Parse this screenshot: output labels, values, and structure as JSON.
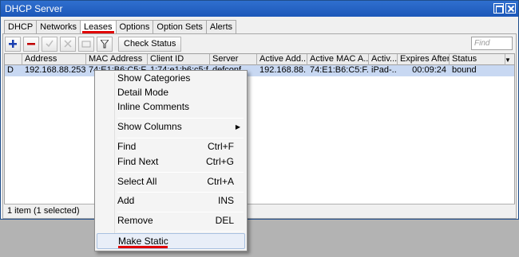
{
  "window": {
    "title": "DHCP Server"
  },
  "tabs": [
    "DHCP",
    "Networks",
    "Leases",
    "Options",
    "Option Sets",
    "Alerts"
  ],
  "toolbar": {
    "check_status": "Check Status",
    "find_placeholder": "Find"
  },
  "columns": [
    "",
    "Address",
    "MAC Address",
    "Client ID",
    "Server",
    "Active Add...",
    "Active MAC A...",
    "Activ...",
    "Expires After",
    "Status"
  ],
  "row": {
    "flag": "D",
    "address": "192.168.88.253",
    "mac": "74:E1:B6:C5:F...",
    "client_id": "1:74:e1:b6:c5:f...",
    "server": "defconf",
    "active_address": "192.168.88...",
    "active_mac": "74:E1:B6:C5:F...",
    "active_host": "iPad-...",
    "expires_after": "00:09:24",
    "status": "bound"
  },
  "status": "1 item (1 selected)",
  "menu": {
    "show_categories": "Show Categories",
    "detail_mode": "Detail Mode",
    "inline_comments": "Inline Comments",
    "show_columns": "Show Columns",
    "find": "Find",
    "find_sc": "Ctrl+F",
    "find_next": "Find Next",
    "find_next_sc": "Ctrl+G",
    "select_all": "Select All",
    "select_all_sc": "Ctrl+A",
    "add": "Add",
    "add_sc": "INS",
    "remove": "Remove",
    "remove_sc": "DEL",
    "make_static": "Make Static"
  },
  "colors": {
    "accent_red": "#e00000",
    "selected_row": "#c8d8f2",
    "title_blue": "#2366c8"
  }
}
